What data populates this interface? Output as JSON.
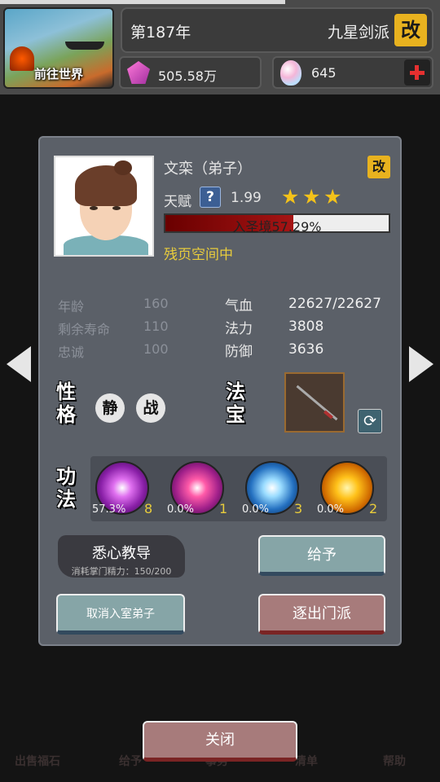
{
  "header": {
    "world_button_label": "前往世界",
    "year": "第187年",
    "sect_name": "九星剑派",
    "rename_label": "改",
    "spirit_stones": "505.58万",
    "gems": "645"
  },
  "disciple": {
    "name": "文栾（弟子）",
    "rename_label": "改",
    "talent_label": "天赋",
    "talent_help": "?",
    "talent_value": "1.99",
    "stars": [
      "★",
      "★",
      "★"
    ],
    "realm_progress_text": "入圣境57.29%",
    "realm_progress": 0.5729,
    "status": "残页空间中",
    "stats_left": [
      {
        "label": "年龄",
        "value": "160"
      },
      {
        "label": "剩余寿命",
        "value": "110"
      },
      {
        "label": "忠诚",
        "value": "100"
      }
    ],
    "stats_right": [
      {
        "label": "气血",
        "value": "22627/22627"
      },
      {
        "label": "法力",
        "value": "3808"
      },
      {
        "label": "防御",
        "value": "3636"
      }
    ],
    "personality_label": "性格",
    "traits": [
      "静",
      "战"
    ],
    "treasure_label": "法宝",
    "skills_label": "功法",
    "skills": [
      {
        "percent": "57.3%",
        "level": "8",
        "icon": "purple-vortex-icon"
      },
      {
        "percent": "0.0%",
        "level": "1",
        "icon": "magenta-slash-icon"
      },
      {
        "percent": "0.0%",
        "level": "3",
        "icon": "ice-shards-icon"
      },
      {
        "percent": "0.0%",
        "level": "2",
        "icon": "golden-bell-icon"
      }
    ]
  },
  "actions": {
    "teach_label": "悉心教导",
    "teach_cost": "消耗掌门精力：150/200",
    "give_label": "给予",
    "cancel_label": "取消入室弟子",
    "expel_label": "逐出门派",
    "close_label": "关闭"
  },
  "background_nav": [
    "出售福石",
    "给予",
    "事务",
    "清单",
    "帮助"
  ],
  "colors": {
    "gold": "#e8b21f",
    "progress": "#a51414",
    "status": "#e8cc3c",
    "panel": "#5b6068"
  }
}
